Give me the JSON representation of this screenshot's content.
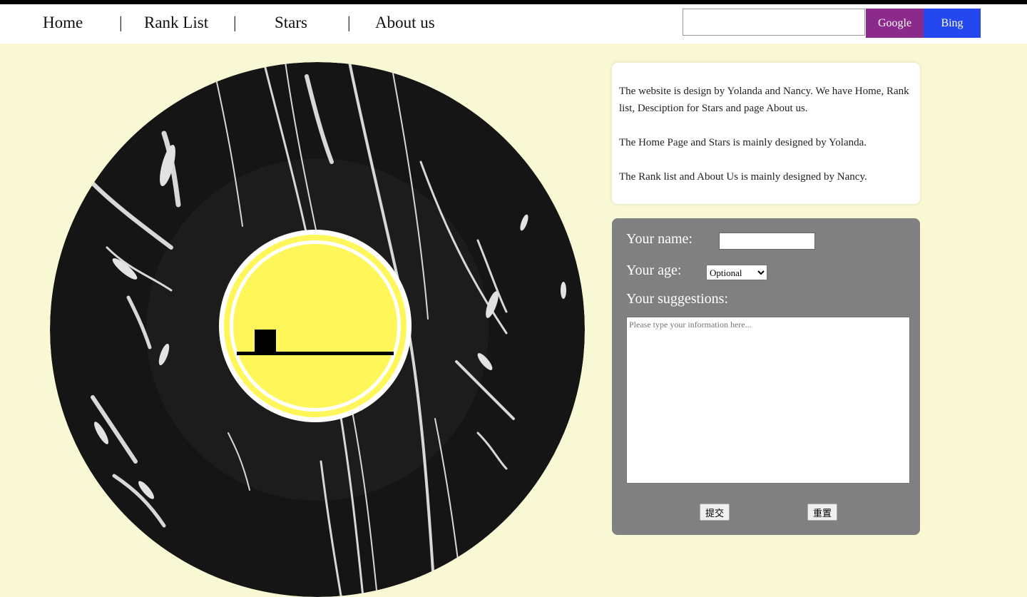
{
  "nav": {
    "items": [
      {
        "label": "Home"
      },
      {
        "label": "Rank List"
      },
      {
        "label": "Stars"
      },
      {
        "label": "About us"
      }
    ],
    "separator": "|"
  },
  "search": {
    "placeholder": "",
    "value": "",
    "google_label": "Google",
    "bing_label": "Bing"
  },
  "info": {
    "paragraphs": [
      "The website is design by Yolanda and Nancy. We have Home, Rank list, Desciption for Stars and page About us.",
      "The Home Page and Stars is mainly designed by Yolanda.",
      "The Rank list and About Us is mainly designed by Nancy."
    ]
  },
  "form": {
    "name_label": "Your name:",
    "age_label": "Your age:",
    "age_selected": "Optional",
    "suggest_label": "Your suggestions:",
    "suggest_placeholder": "Please type your information here...",
    "submit_label": "提交",
    "reset_label": "重置"
  },
  "colors": {
    "page_bg": "#f8f8d4",
    "google": "#8c2a8c",
    "bing": "#2447f0",
    "label_yellow": "#fff75a",
    "form_bg": "#808080"
  }
}
